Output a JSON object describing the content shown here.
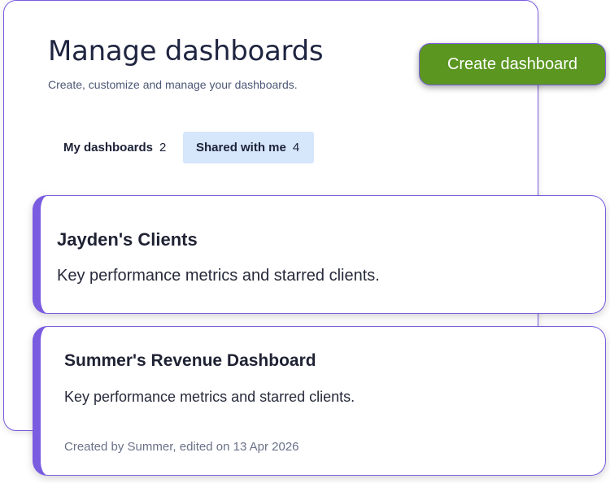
{
  "header": {
    "title": "Manage dashboards",
    "subtitle": "Create, customize and manage your dashboards."
  },
  "actions": {
    "create_label": "Create dashboard"
  },
  "tabs": [
    {
      "label": "My dashboards",
      "count": "2",
      "active": false
    },
    {
      "label": "Shared with me",
      "count": "4",
      "active": true
    }
  ],
  "dashboards": [
    {
      "title": "Jayden's Clients",
      "description": "Key performance metrics and starred clients."
    },
    {
      "title": "Summer's Revenue Dashboard",
      "description": "Key performance metrics and starred clients.",
      "meta": "Created by Summer, edited on 13 Apr 2026"
    }
  ],
  "colors": {
    "accent": "#7a5ce0",
    "primary_button": "#5a9620",
    "active_tab_bg": "#d6e6fb",
    "title_text": "#1f2540"
  }
}
